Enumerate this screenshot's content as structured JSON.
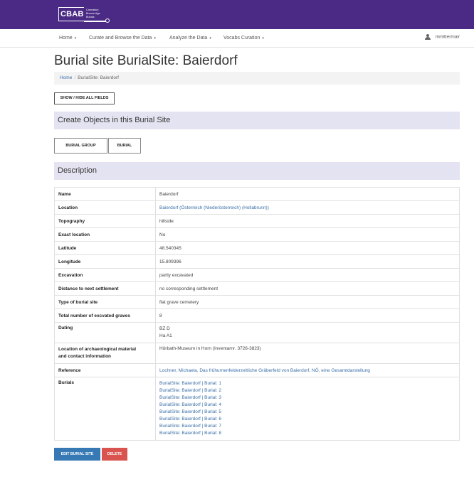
{
  "header": {
    "logo_text": "CBAB",
    "logo_subtitle": [
      "Cremation",
      "Bronze Age",
      "Burials"
    ],
    "brand_color": "#4a2a84"
  },
  "nav": {
    "items": [
      {
        "label": "Home"
      },
      {
        "label": "Curate and Browse the Data"
      },
      {
        "label": "Analyze the Data"
      },
      {
        "label": "Vocabs Curation"
      }
    ],
    "caret": "▾",
    "user": "mmittermair"
  },
  "page": {
    "title": "Burial site BurialSite: Baierdorf"
  },
  "breadcrumb": {
    "home": "Home",
    "separator": "/",
    "current": "BurialSite: Baierdorf"
  },
  "buttons": {
    "toggle_fields": "SHOW / HIDE ALL FIELDS",
    "burial_group": "BURIAL GROUP",
    "burial": "BURIAL",
    "edit": "EDIT BURIAL SITE",
    "delete": "DELETE"
  },
  "panels": {
    "create_objects": "Create Objects in this Burial Site",
    "description": "Description"
  },
  "table": {
    "name": {
      "label": "Name",
      "value": "Baierdorf"
    },
    "location": {
      "label": "Location",
      "value": "Baierdorf (Österreich (Niederösterreich) (Hollabrunn))"
    },
    "topography": {
      "label": "Topography",
      "value": "hillside"
    },
    "exact_location": {
      "label": "Exact location",
      "value": "No"
    },
    "latitude": {
      "label": "Latitude",
      "value": "48.540345"
    },
    "longitude": {
      "label": "Longitude",
      "value": "15.809396"
    },
    "excavation": {
      "label": "Excavation",
      "value": "partly excavated"
    },
    "distance": {
      "label": "Distance to next settlement",
      "value": "no corresponding settlement"
    },
    "type": {
      "label": "Type of burial site",
      "value": "flat grave cemetery"
    },
    "total_graves": {
      "label": "Total number of excvated graves",
      "value": "8"
    },
    "dating": {
      "label": "Dating",
      "values": [
        "BZ D",
        "Ha A1"
      ]
    },
    "archaeological": {
      "label_lines": [
        "Location of archaeological material",
        "and contact information"
      ],
      "value": "Hörbath-Museum in Horn (Inventarnr. 3726-3823)"
    },
    "reference": {
      "label": "Reference",
      "value": "Lochner, Michaela, Das frühurnenfelderzeitliche Gräberfeld von Baierdorf, NÖ, eine Gesamtdarstellung"
    },
    "burials": {
      "label": "Burials",
      "items": [
        "BurialSite: Baierdorf | Burial: 1",
        "BurialSite: Baierdorf | Burial: 2",
        "BurialSite: Baierdorf | Burial: 3",
        "BurialSite: Baierdorf | Burial: 4",
        "BurialSite: Baierdorf | Burial: 5",
        "BurialSite: Baierdorf | Burial: 6",
        "BurialSite: Baierdorf | Burial: 7",
        "BurialSite: Baierdorf | Burial: 8"
      ]
    }
  }
}
